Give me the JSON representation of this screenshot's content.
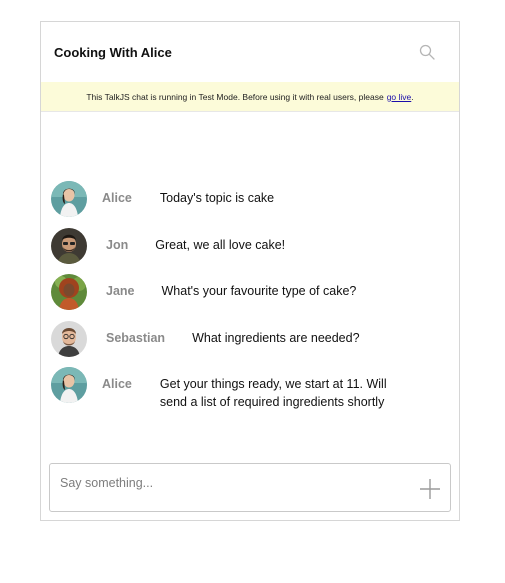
{
  "header": {
    "title": "Cooking With Alice",
    "search_icon": "search-icon"
  },
  "banner": {
    "text": "This TalkJS chat is running in Test Mode. Before using it with real users, please",
    "link_text": "go live",
    "suffix": "."
  },
  "messages": [
    {
      "sender": "Alice",
      "text": "Today's topic is cake",
      "avatar": "avatar-alice"
    },
    {
      "sender": "Jon",
      "text": "Great, we all love cake!",
      "avatar": "avatar-jon"
    },
    {
      "sender": "Jane",
      "text": "What's your favourite type of cake?",
      "avatar": "avatar-jane"
    },
    {
      "sender": "Sebastian",
      "text": "What ingredients are needed?",
      "avatar": "avatar-sebastian"
    },
    {
      "sender": "Alice",
      "text": "Get your things ready, we start at 11. Will send a list of required ingredients shortly",
      "avatar": "avatar-alice"
    }
  ],
  "composer": {
    "placeholder": "Say something...",
    "attach_icon": "plus-icon"
  },
  "colors": {
    "banner_bg": "#fcfbd9",
    "sender_text": "#8a8a8a",
    "link": "#1a0dab",
    "border": "#d6d6d6"
  }
}
